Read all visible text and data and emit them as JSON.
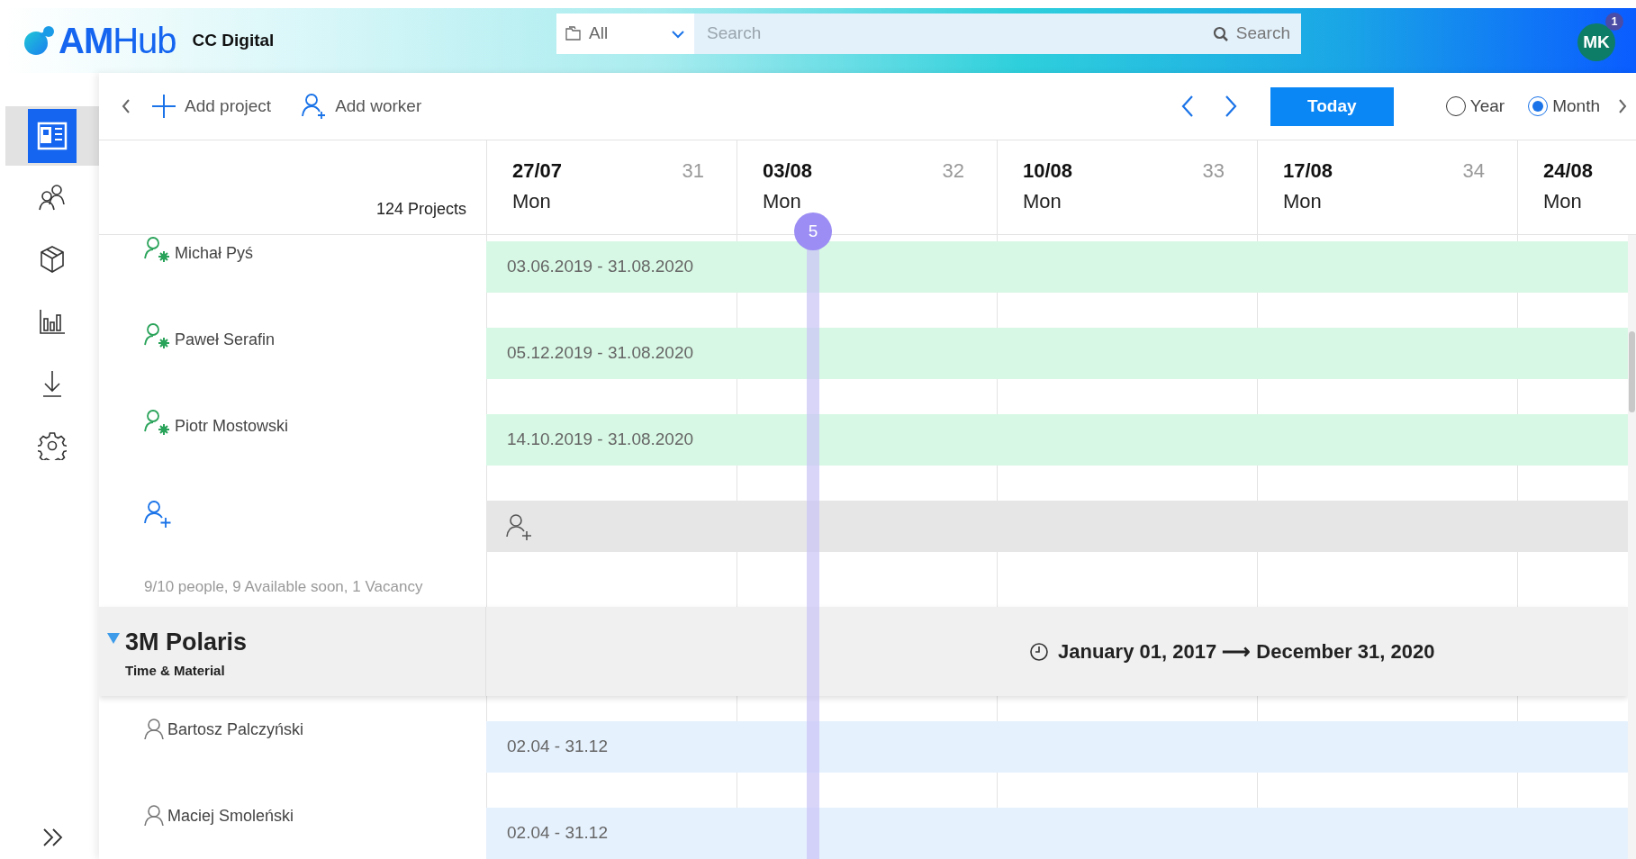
{
  "header": {
    "logo": "**AM**Hub",
    "company": "CC Digital",
    "scope": "All",
    "search_placeholder": "Search",
    "search_button": "Search",
    "avatar": "MK",
    "notifications": "1"
  },
  "sidebar": {
    "items": [
      {
        "kind": "projects",
        "selected": true
      },
      {
        "kind": "people",
        "selected": false
      },
      {
        "kind": "products",
        "selected": false
      },
      {
        "kind": "reports",
        "selected": false
      },
      {
        "kind": "download",
        "selected": false
      },
      {
        "kind": "settings",
        "selected": false
      }
    ]
  },
  "toolbar": {
    "add_project": "Add project",
    "add_worker": "Add worker",
    "today": "Today",
    "views": [
      {
        "label": "Year",
        "selected": false
      },
      {
        "label": "Month",
        "selected": true
      }
    ]
  },
  "timeline": {
    "project_count": "124 Projects",
    "today_marker": "5",
    "weeks": [
      {
        "date": "27/07",
        "week": "31",
        "day": "Mon"
      },
      {
        "date": "03/08",
        "week": "32",
        "day": "Mon"
      },
      {
        "date": "10/08",
        "week": "33",
        "day": "Mon"
      },
      {
        "date": "17/08",
        "week": "34",
        "day": "Mon"
      },
      {
        "date": "24/08",
        "day": "Mon"
      }
    ],
    "rows": [
      {
        "kind": "manager",
        "name": "Michał Pyś",
        "period": "03.06.2019 - 31.08.2020"
      },
      {
        "kind": "manager",
        "name": "Paweł Serafin",
        "period": "05.12.2019 - 31.08.2020"
      },
      {
        "kind": "manager",
        "name": "Piotr Mostowski",
        "period": "14.10.2019 - 31.08.2020"
      },
      {
        "kind": "add_worker"
      },
      {
        "kind": "summary",
        "text": "9/10 people, 9 Available soon, 1 Vacancy"
      },
      {
        "kind": "project",
        "name": "3M Polaris",
        "billing": "Time & Material",
        "period": "January 01, 2017 ⟶ December 31, 2020",
        "expanded": true
      },
      {
        "kind": "worker",
        "name": "Bartosz Palczyński",
        "period": "02.04 - 31.12"
      },
      {
        "kind": "worker",
        "name": "Maciej Smoleński",
        "period": "02.04 - 31.12"
      }
    ]
  }
}
